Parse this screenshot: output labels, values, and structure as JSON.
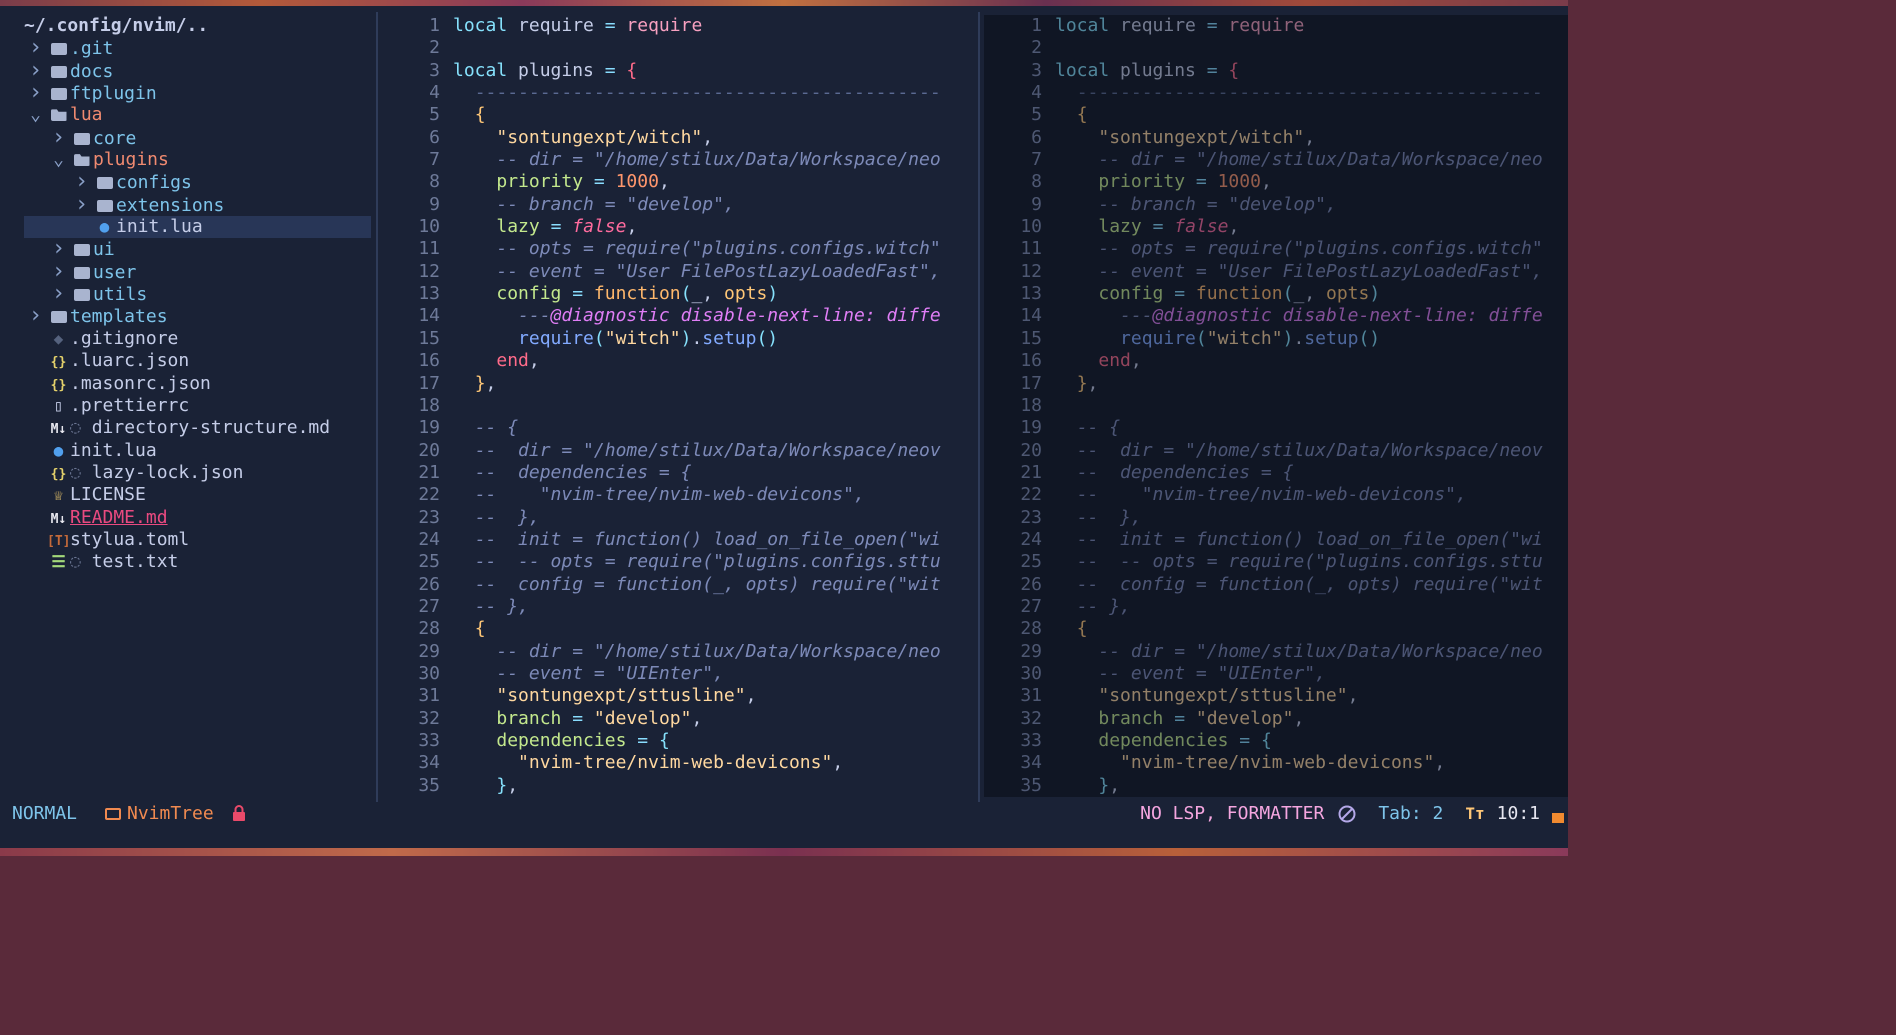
{
  "tree": {
    "root": "~/.config/nvim/..",
    "items": [
      {
        "depth": 0,
        "type": "folder",
        "open": false,
        "name": ".git"
      },
      {
        "depth": 0,
        "type": "folder",
        "open": false,
        "name": "docs"
      },
      {
        "depth": 0,
        "type": "folder",
        "open": false,
        "name": "ftplugin"
      },
      {
        "depth": 0,
        "type": "folder",
        "open": true,
        "name": "lua"
      },
      {
        "depth": 1,
        "type": "folder",
        "open": false,
        "name": "core"
      },
      {
        "depth": 1,
        "type": "folder",
        "open": true,
        "name": "plugins"
      },
      {
        "depth": 2,
        "type": "folder",
        "open": false,
        "name": "configs"
      },
      {
        "depth": 2,
        "type": "folder",
        "open": false,
        "name": "extensions"
      },
      {
        "depth": 2,
        "type": "file",
        "icon": "lua-icon",
        "name": "init.lua",
        "selected": true
      },
      {
        "depth": 1,
        "type": "folder",
        "open": false,
        "name": "ui"
      },
      {
        "depth": 1,
        "type": "folder",
        "open": false,
        "name": "user"
      },
      {
        "depth": 1,
        "type": "folder",
        "open": false,
        "name": "utils"
      },
      {
        "depth": 0,
        "type": "folder",
        "open": false,
        "name": "templates"
      },
      {
        "depth": 0,
        "type": "file",
        "icon": "git-icon",
        "name": ".gitignore"
      },
      {
        "depth": 0,
        "type": "file",
        "icon": "json-icon",
        "name": ".luarc.json"
      },
      {
        "depth": 0,
        "type": "file",
        "icon": "json-icon",
        "name": ".masonrc.json"
      },
      {
        "depth": 0,
        "type": "file",
        "icon": "file-icon",
        "name": ".prettierrc"
      },
      {
        "depth": 0,
        "type": "file",
        "icon": "markdown-icon",
        "name": "directory-structure.md",
        "git": true
      },
      {
        "depth": 0,
        "type": "file",
        "icon": "lua-icon",
        "name": "init.lua"
      },
      {
        "depth": 0,
        "type": "file",
        "icon": "json-icon",
        "name": "lazy-lock.json",
        "git": true
      },
      {
        "depth": 0,
        "type": "file",
        "icon": "license-icon",
        "name": "LICENSE"
      },
      {
        "depth": 0,
        "type": "file",
        "icon": "markdown-icon",
        "name": "README.md",
        "modified": true
      },
      {
        "depth": 0,
        "type": "file",
        "icon": "toml-icon",
        "name": "stylua.toml"
      },
      {
        "depth": 0,
        "type": "file",
        "icon": "text-icon",
        "name": "test.txt",
        "git": true
      }
    ]
  },
  "editor": {
    "lines": [
      [
        [
          "kw",
          "local"
        ],
        [
          "v",
          " require "
        ],
        [
          "op",
          "="
        ],
        [
          "v",
          " "
        ],
        [
          "p",
          "require"
        ]
      ],
      [],
      [
        [
          "kw",
          "local"
        ],
        [
          "v",
          " plugins "
        ],
        [
          "op",
          "="
        ],
        [
          "v",
          " "
        ],
        [
          "br",
          "{"
        ]
      ],
      [
        [
          "v",
          "  "
        ],
        [
          "dash",
          "-------------------------------------------"
        ]
      ],
      [
        [
          "v",
          "  "
        ],
        [
          "br2",
          "{"
        ]
      ],
      [
        [
          "v",
          "    "
        ],
        [
          "str",
          "\"sontungexpt/witch\""
        ],
        [
          "v",
          ","
        ]
      ],
      [
        [
          "v",
          "    "
        ],
        [
          "com",
          "-- dir = \"/home/stilux/Data/Workspace/neo"
        ]
      ],
      [
        [
          "v",
          "    "
        ],
        [
          "key",
          "priority"
        ],
        [
          "v",
          " "
        ],
        [
          "op",
          "="
        ],
        [
          "v",
          " "
        ],
        [
          "num",
          "1000"
        ],
        [
          "v",
          ","
        ]
      ],
      [
        [
          "v",
          "    "
        ],
        [
          "com",
          "-- branch = \"develop\","
        ]
      ],
      [
        [
          "v",
          "    "
        ],
        [
          "key",
          "lazy"
        ],
        [
          "v",
          " "
        ],
        [
          "op",
          "="
        ],
        [
          "v",
          " "
        ],
        [
          "bool",
          "false"
        ],
        [
          "v",
          ","
        ]
      ],
      [
        [
          "v",
          "    "
        ],
        [
          "com",
          "-- opts = require(\"plugins.configs.witch\""
        ]
      ],
      [
        [
          "v",
          "    "
        ],
        [
          "com",
          "-- event = \"User FilePostLazyLoadedFast\","
        ]
      ],
      [
        [
          "v",
          "    "
        ],
        [
          "key",
          "config"
        ],
        [
          "v",
          " "
        ],
        [
          "op",
          "="
        ],
        [
          "v",
          " "
        ],
        [
          "fn",
          "function"
        ],
        [
          "par",
          "("
        ],
        [
          "v",
          "_, "
        ],
        [
          "id",
          "opts"
        ],
        [
          "par",
          ")"
        ]
      ],
      [
        [
          "v",
          "      "
        ],
        [
          "com",
          "---"
        ],
        [
          "ann",
          "@diagnostic disable-next-line: diffe"
        ]
      ],
      [
        [
          "v",
          "      "
        ],
        [
          "req",
          "require"
        ],
        [
          "par",
          "("
        ],
        [
          "str",
          "\"witch\""
        ],
        [
          "par",
          ")"
        ],
        [
          "v",
          "."
        ],
        [
          "req",
          "setup"
        ],
        [
          "par",
          "()"
        ]
      ],
      [
        [
          "v",
          "    "
        ],
        [
          "br",
          "end"
        ],
        [
          "v",
          ","
        ]
      ],
      [
        [
          "v",
          "  "
        ],
        [
          "br2",
          "}"
        ],
        [
          "v",
          ","
        ]
      ],
      [],
      [
        [
          "v",
          "  "
        ],
        [
          "com",
          "-- {"
        ]
      ],
      [
        [
          "v",
          "  "
        ],
        [
          "com",
          "--  dir = \"/home/stilux/Data/Workspace/neov"
        ]
      ],
      [
        [
          "v",
          "  "
        ],
        [
          "com",
          "--  dependencies = {"
        ]
      ],
      [
        [
          "v",
          "  "
        ],
        [
          "com",
          "--    \"nvim-tree/nvim-web-devicons\","
        ]
      ],
      [
        [
          "v",
          "  "
        ],
        [
          "com",
          "--  },"
        ]
      ],
      [
        [
          "v",
          "  "
        ],
        [
          "com",
          "--  init = function() load_on_file_open(\"wi"
        ]
      ],
      [
        [
          "v",
          "  "
        ],
        [
          "com",
          "--  -- opts = require(\"plugins.configs.sttu"
        ]
      ],
      [
        [
          "v",
          "  "
        ],
        [
          "com",
          "--  config = function(_, opts) require(\"wit"
        ]
      ],
      [
        [
          "v",
          "  "
        ],
        [
          "com",
          "-- },"
        ]
      ],
      [
        [
          "v",
          "  "
        ],
        [
          "br2",
          "{"
        ]
      ],
      [
        [
          "v",
          "    "
        ],
        [
          "com",
          "-- dir = \"/home/stilux/Data/Workspace/neo"
        ]
      ],
      [
        [
          "v",
          "    "
        ],
        [
          "com",
          "-- event = \"UIEnter\","
        ]
      ],
      [
        [
          "v",
          "    "
        ],
        [
          "str",
          "\"sontungexpt/sttusline\""
        ],
        [
          "v",
          ","
        ]
      ],
      [
        [
          "v",
          "    "
        ],
        [
          "key",
          "branch"
        ],
        [
          "v",
          " "
        ],
        [
          "op",
          "="
        ],
        [
          "v",
          " "
        ],
        [
          "str",
          "\"develop\""
        ],
        [
          "v",
          ","
        ]
      ],
      [
        [
          "v",
          "    "
        ],
        [
          "key",
          "dependencies"
        ],
        [
          "v",
          " "
        ],
        [
          "op",
          "="
        ],
        [
          "v",
          " "
        ],
        [
          "par",
          "{"
        ]
      ],
      [
        [
          "v",
          "      "
        ],
        [
          "str",
          "\"nvim-tree/nvim-web-devicons\""
        ],
        [
          "v",
          ","
        ]
      ],
      [
        [
          "v",
          "    "
        ],
        [
          "par",
          "}"
        ],
        [
          "v",
          ","
        ]
      ]
    ]
  },
  "statusline": {
    "mode": "NORMAL",
    "buffer": "NvimTree",
    "lsp": "NO LSP, FORMATTER",
    "tab": "Tab: 2",
    "tt": "Tт",
    "position": "10:1"
  }
}
